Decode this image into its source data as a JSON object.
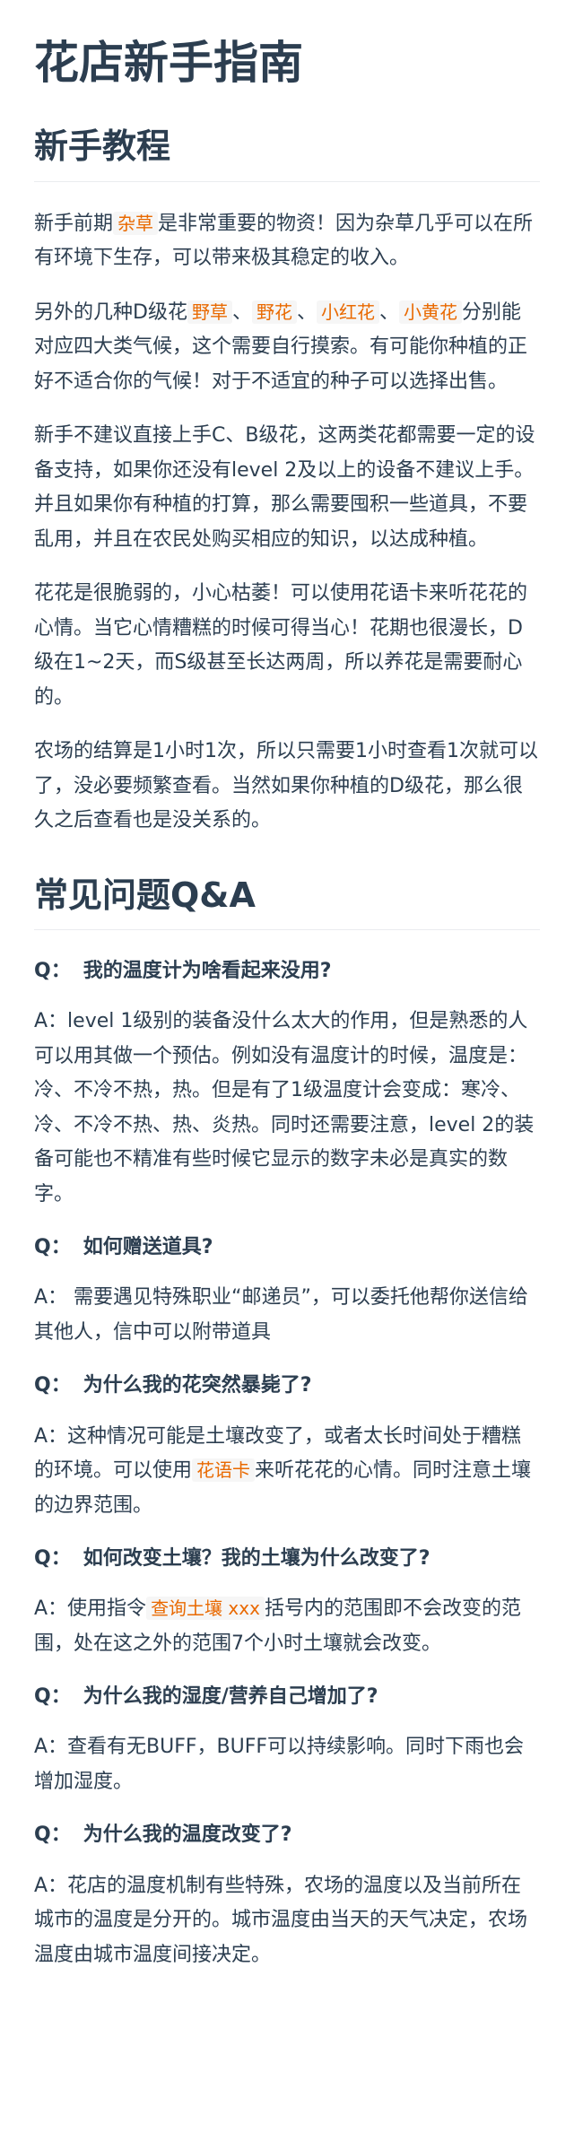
{
  "title": "花店新手指南",
  "tutorial": {
    "heading": "新手教程",
    "p1": {
      "a": "新手前期",
      "tag": "杂草",
      "b": "是非常重要的物资！因为杂草几乎可以在所有环境下生存，可以带来极其稳定的收入。"
    },
    "p2": {
      "a": "另外的几种D级花",
      "tag1": "野草",
      "sep1": "、",
      "tag2": "野花",
      "sep2": "、",
      "tag3": "小红花",
      "sep3": "、",
      "tag4": "小黄花",
      "b": "分别能对应四大类气候，这个需要自行摸索。有可能你种植的正好不适合你的气候！对于不适宜的种子可以选择出售。"
    },
    "p3": "新手不建议直接上手C、B级花，这两类花都需要一定的设备支持，如果你还没有level 2及以上的设备不建议上手。并且如果你有种植的打算，那么需要囤积一些道具，不要乱用，并且在农民处购买相应的知识，以达成种植。",
    "p4": "花花是很脆弱的，小心枯萎！可以使用花语卡来听花花的心情。当它心情糟糕的时候可得当心！花期也很漫长，D级在1~2天，而S级甚至长达两周，所以养花是需要耐心的。",
    "p5": "农场的结算是1小时1次，所以只需要1小时查看1次就可以了，没必要频繁查看。当然如果你种植的D级花，那么很久之后查看也是没关系的。"
  },
  "faq": {
    "heading": "常见问题Q&A",
    "q_prefix": "Q：",
    "items": [
      {
        "q": "我的温度计为啥看起来没用?",
        "a": "A：level 1级别的装备没什么太大的作用，但是熟悉的人可以用其做一个预估。例如没有温度计的时候，温度是：冷、不冷不热，热。但是有了1级温度计会变成：寒冷、冷、不冷不热、热、炎热。同时还需要注意，level 2的装备可能也不精准有些时候它显示的数字未必是真实的数字。"
      },
      {
        "q": "如何赠送道具?",
        "a": "A： 需要遇见特殊职业“邮递员”，可以委托他帮你送信给其他人，信中可以附带道具"
      },
      {
        "q": "为什么我的花突然暴毙了?",
        "a_pre": "A：这种情况可能是土壤改变了，或者太长时间处于糟糕的环境。可以使用",
        "a_tag": "花语卡",
        "a_post": "来听花花的心情。同时注意土壤的边界范围。"
      },
      {
        "q": "如何改变土壤？我的土壤为什么改变了?",
        "a_pre": "A：使用指令",
        "a_tag": "查询土壤 xxx",
        "a_post": "括号内的范围即不会改变的范围，处在这之外的范围7个小时土壤就会改变。"
      },
      {
        "q": "为什么我的湿度/营养自己增加了?",
        "a": "A：查看有无BUFF，BUFF可以持续影响。同时下雨也会增加湿度。"
      },
      {
        "q": "为什么我的温度改变了?",
        "a": "A：花店的温度机制有些特殊，农场的温度以及当前所在城市的温度是分开的。城市温度由当天的天气决定，农场温度由城市温度间接决定。"
      }
    ]
  },
  "colors": {
    "text": "#2c3e50",
    "tag": "#e96900",
    "tag_bg": "#f6f6f6",
    "divider": "#eaecef"
  }
}
